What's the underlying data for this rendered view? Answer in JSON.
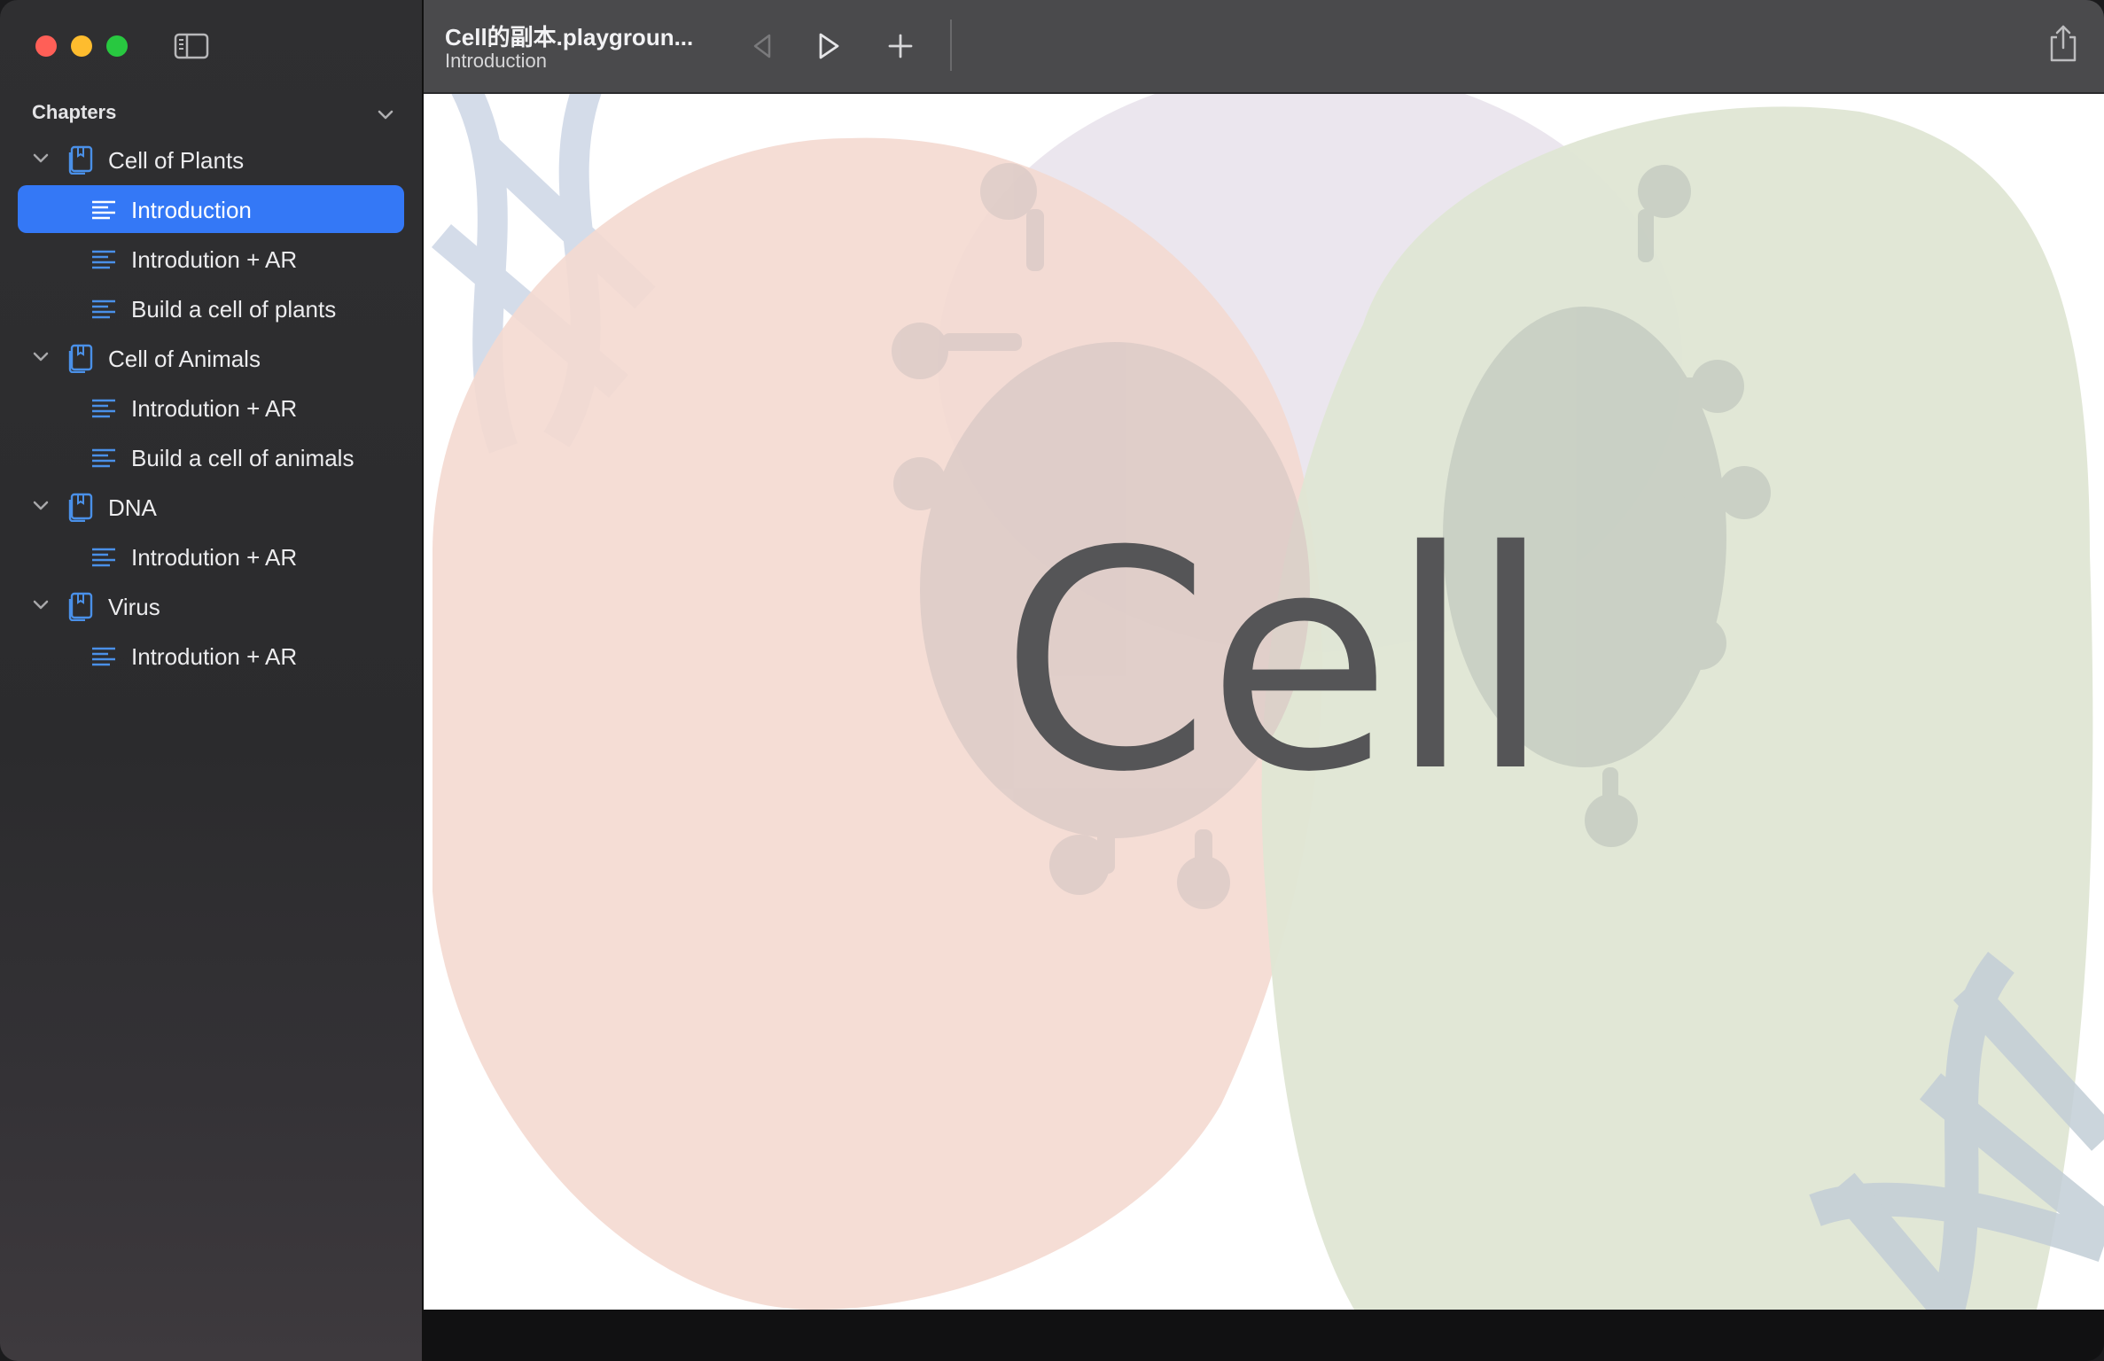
{
  "window": {
    "title": "Cell的副本.playgroun...",
    "subtitle": "Introduction"
  },
  "sidebar": {
    "header": "Chapters",
    "chapters": [
      {
        "label": "Cell of Plants",
        "pages": [
          "Introduction",
          "Introdution + AR",
          "Build a cell of plants"
        ]
      },
      {
        "label": "Cell of Animals",
        "pages": [
          "Introdution + AR",
          "Build a cell of animals"
        ]
      },
      {
        "label": "DNA",
        "pages": [
          "Introdution + AR"
        ]
      },
      {
        "label": "Virus",
        "pages": [
          "Introdution + AR"
        ]
      }
    ],
    "selected_page": "Introduction"
  },
  "content": {
    "headline": "Cell"
  },
  "colors": {
    "accent": "#3478f6",
    "icon_blue": "#4a90e8",
    "plant_cell": "#f4d9d0",
    "animal_cell": "#dfe6d4",
    "dna": "#cdd6e6",
    "virus": "#d9c9c6"
  },
  "icons": [
    "sidebar-toggle-icon",
    "back-icon",
    "play-icon",
    "plus-icon",
    "share-icon",
    "chevron-down-icon",
    "chapter-book-icon",
    "page-lines-icon"
  ]
}
